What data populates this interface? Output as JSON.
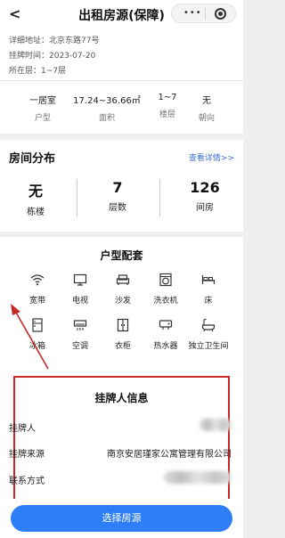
{
  "header": {
    "back_icon": "chevron-left-icon",
    "title": "出租房源(保障)",
    "menu_dots": "•••"
  },
  "info": {
    "address": "详细地址：北京东路77号",
    "listing_time": "挂牌时间：2023-07-20",
    "floor": "所在层：1~7层"
  },
  "stats": [
    {
      "value": "一居室",
      "label": "户型"
    },
    {
      "value": "17.24~36.66㎡",
      "label": "面积"
    },
    {
      "value": "1~7",
      "label": "楼层"
    },
    {
      "value": "无",
      "label": "朝向"
    }
  ],
  "distribution": {
    "title": "房间分布",
    "more": "查看详情>>",
    "items": [
      {
        "value": "无",
        "label": "栋楼"
      },
      {
        "value": "7",
        "label": "层数"
      },
      {
        "value": "126",
        "label": "间房"
      }
    ]
  },
  "amenities": {
    "title": "户型配套",
    "items": [
      {
        "label": "宽带",
        "icon": "wifi-icon"
      },
      {
        "label": "电视",
        "icon": "tv-icon"
      },
      {
        "label": "沙发",
        "icon": "sofa-icon"
      },
      {
        "label": "洗衣机",
        "icon": "washing-machine-icon"
      },
      {
        "label": "床",
        "icon": "bed-icon"
      },
      {
        "label": "冰箱",
        "icon": "fridge-icon"
      },
      {
        "label": "空调",
        "icon": "air-conditioner-icon"
      },
      {
        "label": "衣柜",
        "icon": "wardrobe-icon"
      },
      {
        "label": "热水器",
        "icon": "water-heater-icon"
      },
      {
        "label": "独立卫生间",
        "icon": "bathroom-icon"
      }
    ]
  },
  "lister": {
    "title": "挂牌人信息",
    "rows": [
      {
        "key": "挂牌人",
        "value": ""
      },
      {
        "key": "挂牌来源",
        "value": "南京安居瑾家公寓管理有限公司"
      },
      {
        "key": "联系方式",
        "value": ""
      }
    ]
  },
  "footer": {
    "select_button": "选择房源"
  },
  "colors": {
    "accent": "#2d7ef7",
    "highlight_box": "#c62828",
    "link": "#3a6fd0"
  }
}
